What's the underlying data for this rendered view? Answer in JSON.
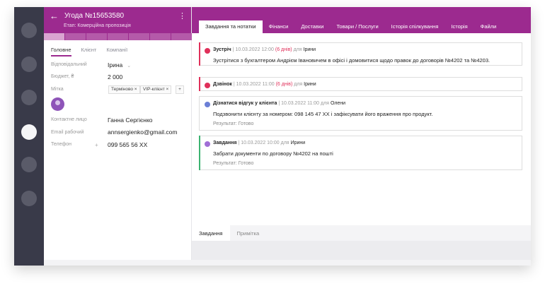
{
  "rail": {
    "items": 6,
    "active": 4
  },
  "deal": {
    "title": "Угода №15653580",
    "stage": "Етап: Комерційна пропозиція",
    "tabs": [
      "Головне",
      "Клієнт",
      "Компанії"
    ],
    "fields": {
      "responsible_label": "Відповідальний",
      "responsible_value": "Ірина",
      "budget_label": "Бюджет, ₴",
      "budget_value": "2 000",
      "tag_label": "Мітка",
      "tags": [
        "Терміново",
        "VIP-клієнт"
      ],
      "contact_label": "Контактне лицо",
      "contact_value": "Ганна Сергієнко",
      "email_label": "Email рабочий",
      "email_value": "annsergienko@gmail.com",
      "phone_label": "Телефон",
      "phone_value": "099 565 56 XX"
    }
  },
  "main": {
    "tabs": [
      "Завдання та нотатки",
      "Фінанси",
      "Доставки",
      "Товари / Послуги",
      "Історія спілкування",
      "Історія",
      "Файли"
    ],
    "cards": [
      {
        "type": "Зустріч",
        "datetime": "10.03.2022 12:00",
        "late": "(6 днів)",
        "for": "для",
        "who": "Ірини",
        "text": "Зустрітися з бухгалтером Андрієм Івановичем в офісі і домовитися щодо правок до договорів №4202 та №4203.",
        "result": "",
        "color": "#e0305a"
      },
      {
        "type": "Дзвінок",
        "datetime": "10.03.2022 11:00",
        "late": "(6 днів)",
        "for": "для",
        "who": "Ірини",
        "text": "",
        "result": "",
        "color": "#e0305a"
      },
      {
        "type": "Дізнатися відгук у клієнта",
        "datetime": "10.03.2022 11:00",
        "late": "",
        "for": "для",
        "who": "Олени",
        "text": "Подзвонити клієнту за номером: 098 145 47 XX  і зафіксувати його враження про продукт.",
        "result": "Результат: Готово",
        "color": "#6b7fd6"
      },
      {
        "type": "Завдання",
        "datetime": "10.03.2022 10:00",
        "late": "",
        "for": "для",
        "who": "Ирини",
        "text": "Забрати документи по договору №4202 на пошті",
        "result": "Результат: Готово",
        "color": "#a06fd6"
      }
    ],
    "bottom_tabs": [
      "Завдання",
      "Примітка"
    ]
  }
}
